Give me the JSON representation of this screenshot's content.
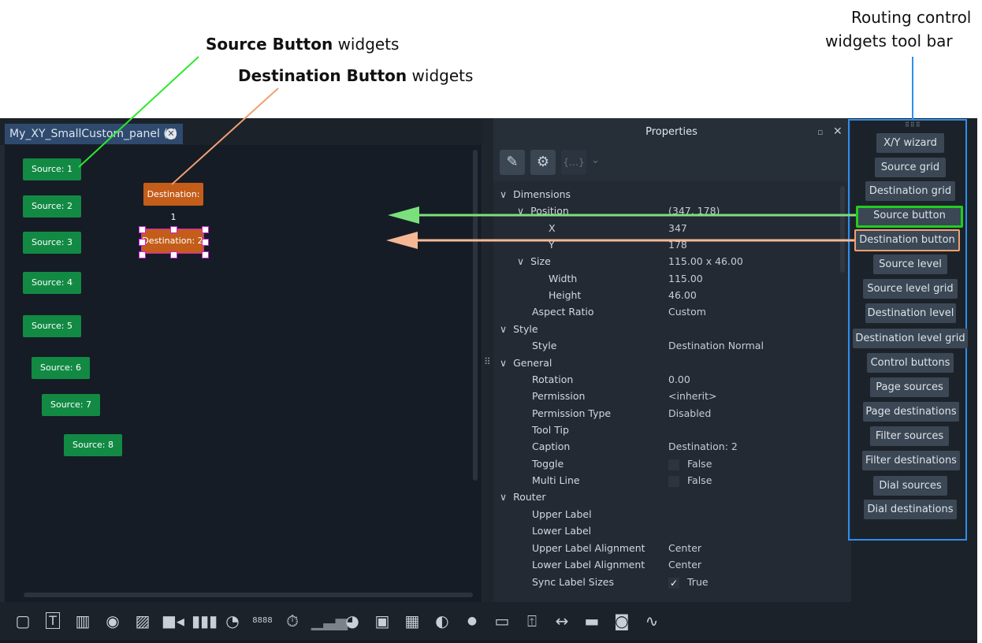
{
  "callouts": {
    "source_bold": "Source Button",
    "source_rest": "widgets",
    "dest_bold": "Destination Button",
    "dest_rest": "widgets",
    "toolbar_line1": "Routing control",
    "toolbar_line2": "widgets tool bar"
  },
  "editor": {
    "tab_title": "My_XY_SmallCustom_panel (*)",
    "tab_close_icon": "close-circle-icon",
    "sources": [
      "Source: 1",
      "Source: 2",
      "Source: 3",
      "Source: 4",
      "Source: 5",
      "Source: 6",
      "Source: 7",
      "Source: 8"
    ],
    "destinations": [
      "Destination: 1",
      "Destination: 2"
    ],
    "colors": {
      "source": "#128a44",
      "destination": "#c45d1a",
      "selection": "#d01fd0"
    }
  },
  "properties": {
    "title": "Properties",
    "toolbar_icons": [
      "edit-icon",
      "settings-icon",
      "script-icon",
      "chevron-down-icon"
    ],
    "rows": {
      "dimensions": "Dimensions",
      "position": "Position",
      "position_value": "(347, 178)",
      "x": "X",
      "x_value": "347",
      "y": "Y",
      "y_value": "178",
      "size": "Size",
      "size_value": "115.00 x 46.00",
      "width": "Width",
      "width_value": "115.00",
      "height": "Height",
      "height_value": "46.00",
      "aspect_ratio": "Aspect Ratio",
      "aspect_ratio_value": "Custom",
      "style_group": "Style",
      "style": "Style",
      "style_value": "Destination Normal",
      "general": "General",
      "rotation": "Rotation",
      "rotation_value": "0.00",
      "permission": "Permission",
      "permission_value": "<inherit>",
      "permission_type": "Permission Type",
      "permission_type_value": "Disabled",
      "tool_tip": "Tool Tip",
      "caption": "Caption",
      "caption_value": "Destination: 2",
      "toggle": "Toggle",
      "toggle_value": "False",
      "multi_line": "Multi Line",
      "multi_line_value": "False",
      "router": "Router",
      "upper_label": "Upper Label",
      "lower_label": "Lower Label",
      "upper_label_alignment": "Upper Label Alignment",
      "upper_label_alignment_value": "Center",
      "lower_label_alignment": "Lower Label Alignment",
      "lower_label_alignment_value": "Center",
      "sync_label_sizes": "Sync Label Sizes",
      "sync_label_sizes_value": "True"
    }
  },
  "routing_toolbar": {
    "buttons": [
      "X/Y wizard",
      "Source grid",
      "Destination grid",
      "Source button",
      "Destination button",
      "Source level",
      "Source level grid",
      "Destination level",
      "Destination level grid",
      "Control buttons",
      "Page sources",
      "Page destinations",
      "Filter sources",
      "Filter destinations",
      "Dial sources",
      "Dial destinations"
    ],
    "highlight_colors": {
      "source_button": "#22cc22",
      "destination_button": "#f0a070",
      "frame": "#2d8ef0"
    }
  },
  "bottom_toolbar": {
    "icons": [
      "rectangle-icon",
      "text-icon",
      "panel-icon",
      "circle-icon",
      "image-icon",
      "video-icon",
      "level-meter-icon",
      "clock-icon",
      "counter-icon",
      "timer-icon",
      "chart-icon",
      "pie-chart-icon",
      "picture-icon",
      "grid-icon",
      "dial-icon",
      "dot-icon",
      "slider-icon",
      "export-icon",
      "stretch-icon",
      "line-icon",
      "speaker-icon",
      "waveform-icon"
    ]
  }
}
